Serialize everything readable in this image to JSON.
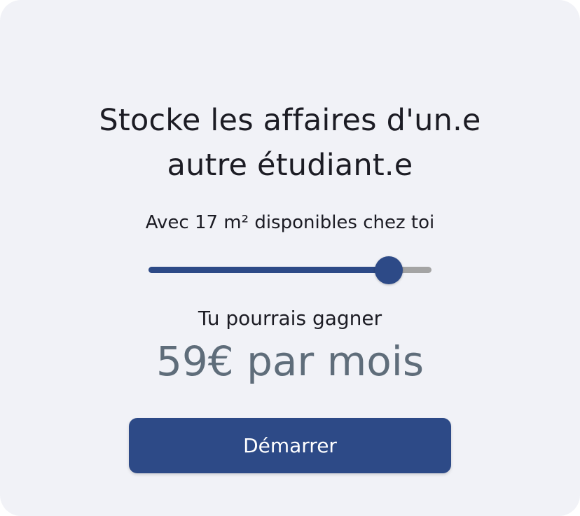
{
  "card": {
    "title_line1": "Stocke les affaires d'un.e",
    "title_line2": "autre étudiant.e",
    "subtitle": "Avec 17 m² disponibles chez toi",
    "slider": {
      "value_fraction": 0.85
    },
    "earn_label": "Tu pourrais gagner",
    "earn_amount": "59€ par mois",
    "start_button_label": "Démarrer"
  },
  "colors": {
    "background": "#f1f2f7",
    "accent": "#2d4a87",
    "track_inactive": "#a4a4a4",
    "text": "#1c1c24",
    "amount_text": "#5f6d7a",
    "button_text": "#ffffff"
  }
}
